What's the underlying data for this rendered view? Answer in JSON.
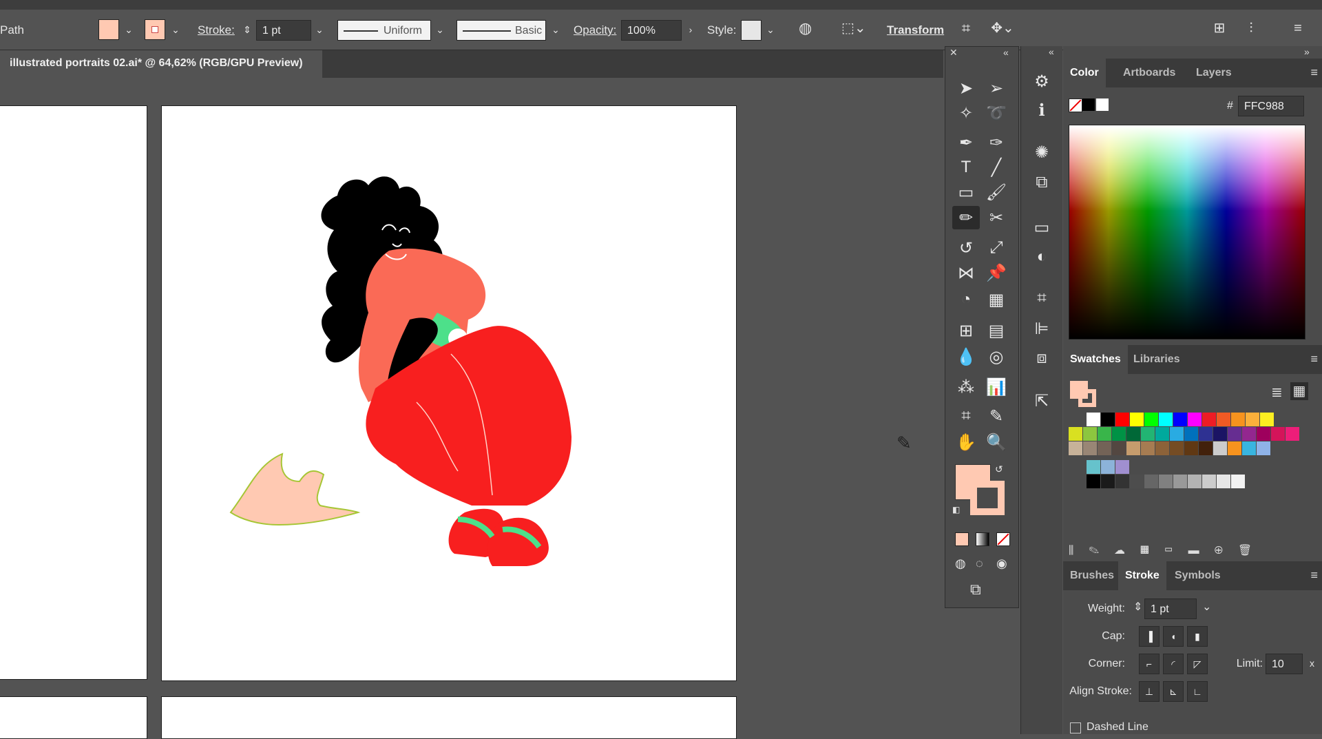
{
  "control_bar": {
    "object_type": "Path",
    "fill_color": "#FFC9B2",
    "stroke_label": "Stroke:",
    "stroke_weight": "1 pt",
    "variable_width_profile": "Uniform",
    "brush_definition": "Basic",
    "opacity_label": "Opacity:",
    "opacity_value": "100%",
    "style_label": "Style:",
    "transform_label": "Transform"
  },
  "document_tab": {
    "title": "illustrated portraits 02.ai* @ 64,62% (RGB/GPU Preview)"
  },
  "color_panel": {
    "tabs": [
      "Color",
      "Artboards",
      "Layers"
    ],
    "active_tab": "Color",
    "hex_prefix": "#",
    "hex_value": "FFC988"
  },
  "swatches_panel": {
    "tabs": [
      "Swatches",
      "Libraries"
    ],
    "active_tab": "Swatches",
    "row1": [
      "#ffffff",
      "#000000",
      "#ff0000",
      "#ffff00",
      "#00ff00",
      "#00ffff",
      "#0000ff",
      "#ff00ff",
      "#ee1c25",
      "#f15a24",
      "#f7931e",
      "#fbb03b",
      "#fcee21"
    ],
    "row2": [
      "#d9e021",
      "#8cc63f",
      "#39b54a",
      "#009245",
      "#006837",
      "#22b573",
      "#00a99d",
      "#29abe2",
      "#0071bc",
      "#2e3192",
      "#1b1464",
      "#662d91",
      "#93278f",
      "#9e005d",
      "#d4145a",
      "#ed1e79"
    ],
    "row3": [
      "#c7b299",
      "#998675",
      "#736357",
      "#534741",
      "#c69c6d",
      "#a67c52",
      "#8c6239",
      "#754c24",
      "#603813",
      "#42210b",
      "#cccccc",
      "#f7931e",
      "#39b5e0",
      "#8fb3e8"
    ],
    "row4": [
      "#66c2cc",
      "#8cb3d9",
      "#a08fd0"
    ],
    "row5": [
      "#000000",
      "#1a1a1a",
      "#333333",
      "#4d4d4d",
      "#666666",
      "#808080",
      "#999999",
      "#b3b3b3",
      "#cccccc",
      "#e6e6e6",
      "#f2f2f2"
    ]
  },
  "stroke_panel": {
    "tabs": [
      "Brushes",
      "Stroke",
      "Symbols"
    ],
    "active_tab": "Stroke",
    "weight_label": "Weight:",
    "weight_value": "1 pt",
    "cap_label": "Cap:",
    "corner_label": "Corner:",
    "limit_label": "Limit:",
    "limit_value": "10",
    "limit_unit": "x",
    "align_label": "Align Stroke:",
    "dashed_label": "Dashed Line"
  },
  "tools": {
    "fill_color": "#FFC9B2",
    "stroke_color": "#FFC9B2"
  }
}
